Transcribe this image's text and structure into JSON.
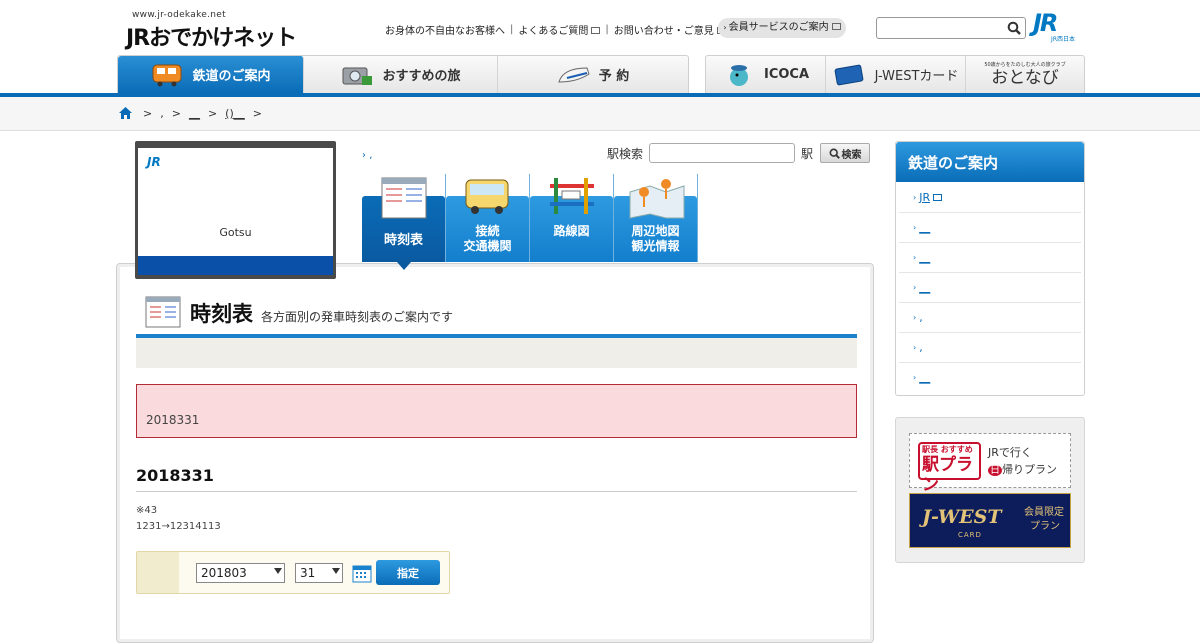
{
  "header": {
    "logo_url": "www.jr-odekake.net",
    "logo_text": "JRおでかけネット",
    "util_links": [
      "お身体の不自由なお客様へ",
      "よくあるご質問",
      "お問い合わせ・ご意見"
    ],
    "member_button": "会員サービスのご案内",
    "search_placeholder": "",
    "corp_logo": "JR",
    "corp_sub": "JR西日本"
  },
  "global_nav": {
    "left": [
      "鉄道のご案内",
      "おすすめの旅",
      "予 約"
    ],
    "right": [
      "ICOCA",
      "J-WESTカード",
      "おとなび"
    ],
    "otonabi_tagline": "50歳からをたのしむ大人の旅クラブ"
  },
  "breadcrumb": [
    ",",
    "__",
    "()__"
  ],
  "station": {
    "card_logo": "JR",
    "name": "Gotsu",
    "top_link": ",",
    "search_label": "駅検索",
    "search_suffix": "駅",
    "search_button": "検索"
  },
  "station_tabs": [
    "時刻表",
    "接続\n交通機関",
    "路線図",
    "周辺地図\n観光情報"
  ],
  "timetable": {
    "title": "時刻表",
    "subtitle": "各方面別の発車時刻表のご案内です",
    "notice": "2018331",
    "date_heading": "2018331",
    "note_lines": [
      "※43",
      "1231→12314113"
    ],
    "month_value": "201803",
    "day_value": "31",
    "submit": "指定"
  },
  "side_menu": {
    "title": "鉄道のご案内",
    "items": [
      "JR",
      "__",
      "__",
      "__",
      ",",
      ",",
      "__"
    ]
  },
  "banners": {
    "b1_small": "駅長 おすすめ",
    "b1_big": "駅プラン",
    "b1_line1": "JRで行く",
    "b1_circle": "日",
    "b1_line2": "帰りプラン",
    "b2_logo": "J-WEST",
    "b2_logo_sub": "CARD",
    "b2_line1": "会員限定",
    "b2_line2": "プラン"
  },
  "colors": {
    "brand_blue": "#0a6cb7",
    "alert_bg": "#fadadd",
    "alert_border": "#b32b37"
  }
}
